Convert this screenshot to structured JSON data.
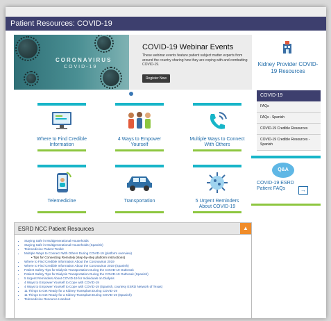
{
  "page_title": "Patient Resources: COVID-19",
  "banner": {
    "image_title": "CORONAVIRUS",
    "image_subtitle": "COVID-19",
    "heading": "COVID-19 Webinar Events",
    "description": "These webinar events feature patient subject matter experts from around the country sharing how they are coping with and combatting COVID-19.",
    "button_label": "Register Now"
  },
  "tiles": [
    {
      "label": "Where to Find Credible Information",
      "icon": "computer-icon"
    },
    {
      "label": "4 Ways to Empower Yourself",
      "icon": "people-icon"
    },
    {
      "label": "Multiple Ways to Connect With Others",
      "icon": "phone-icon"
    },
    {
      "label": "Telemedicine",
      "icon": "smartphone-icon"
    },
    {
      "label": "Transportation",
      "icon": "car-icon"
    },
    {
      "label": "5 Urgent Reminders About COVID-19",
      "icon": "virus-icon"
    }
  ],
  "sidebar": {
    "kidney_link": "Kidney Provider COVID-19 Resources",
    "menu_title": "COVID-19",
    "menu_items": [
      "FAQs",
      "FAQs - Spanish",
      "COVID-19 Credible Resources",
      "COVID-19 Credible Resources - Spanish"
    ],
    "qa_bubble": "Q&A",
    "qa_label": "COVID-19 ESRD Patient FAQs",
    "qa_arrow": "→"
  },
  "esrd": {
    "title": "ESRD NCC Patient Resources",
    "toggle": "▲",
    "links": [
      "Staying Safe in Multigenerational Households",
      "Staying Safe in Multigenerational Households (Spanish)",
      "Telemedicine Patient Toolkit",
      "Multiple Ways to Connect With Others During COVID-19 (platform overview)",
      "Tips for Connecting Remotely (step-by-step platform instructions)",
      "Where to Find Credible Information About the Coronavirus 2019",
      "Where to Find Credible Information About the Coronavirus 2019 (Spanish)",
      "Patient Safety Tips for Dialysis Transportation During the COVID-19 Outbreak",
      "Patient Safety Tips for Dialysis Transportation During the COVID-19 Outbreak (Spanish)",
      "5 Urgent Reminders About COVID-19 for Individuals on Dialysis",
      "4 Ways to Empower Yourself to Cope with COVID-19",
      "4 Ways to Empower Yourself to Cope with COVID-19 (Spanish, courtesy ESRD Network of Texas)",
      "11 Things to Get Ready for a Kidney Transplant During COVID-19",
      "11 Things to Get Ready for a Kidney Transplant During COVID-19 (Spanish)",
      "Telemedicine Resource Handout"
    ]
  }
}
